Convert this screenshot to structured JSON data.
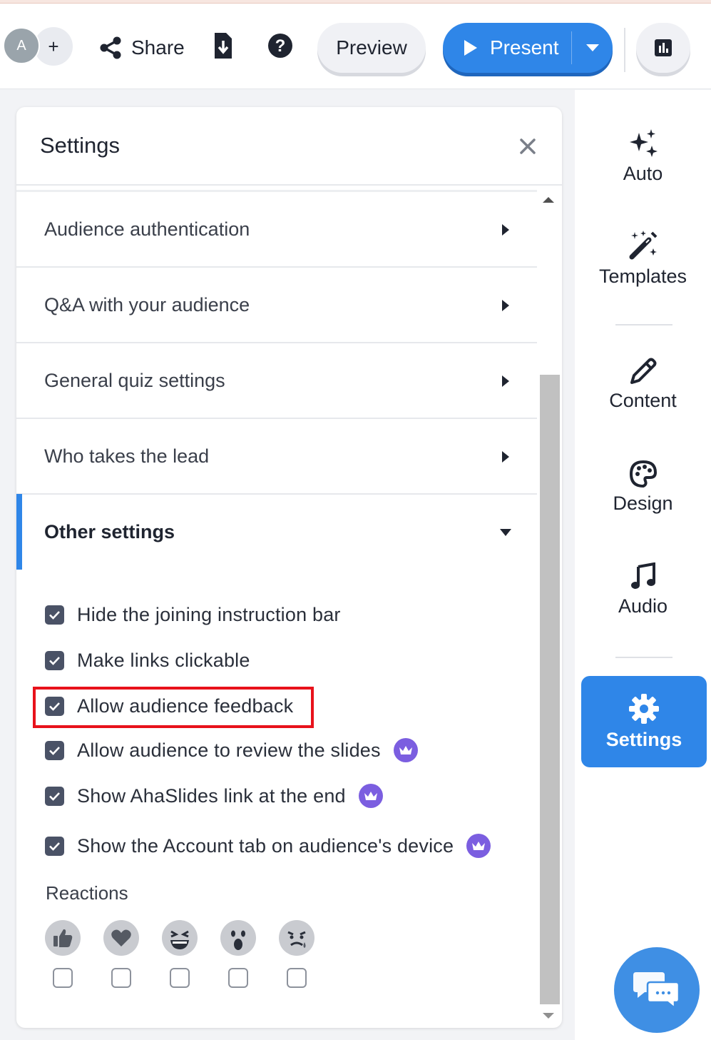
{
  "topbar": {
    "avatar_initial": "A",
    "add_label": "+",
    "share_label": "Share",
    "preview_label": "Preview",
    "present_label": "Present"
  },
  "settings": {
    "title": "Settings",
    "sections": [
      {
        "label": "Audience authentication"
      },
      {
        "label": "Q&A with your audience"
      },
      {
        "label": "General quiz settings"
      },
      {
        "label": "Who takes the lead"
      },
      {
        "label": "Other settings"
      }
    ],
    "options": [
      {
        "label": "Hide the joining instruction bar",
        "checked": true,
        "premium": false
      },
      {
        "label": "Make links clickable",
        "checked": true,
        "premium": false
      },
      {
        "label": "Allow audience feedback",
        "checked": true,
        "premium": false
      },
      {
        "label": "Allow audience to review the slides",
        "checked": true,
        "premium": true
      },
      {
        "label": "Show AhaSlides link at the end",
        "checked": true,
        "premium": true
      },
      {
        "label": "Show the Account tab on audience's device",
        "checked": true,
        "premium": true
      }
    ],
    "reactions_title": "Reactions",
    "reactions": [
      {
        "icon": "thumbs-up-icon",
        "checked": false
      },
      {
        "icon": "heart-icon",
        "checked": false
      },
      {
        "icon": "laughing-face-icon",
        "checked": false
      },
      {
        "icon": "surprised-face-icon",
        "checked": false
      },
      {
        "icon": "sad-face-icon",
        "checked": false
      }
    ]
  },
  "sidebar": {
    "items": [
      {
        "label": "Auto"
      },
      {
        "label": "Templates"
      },
      {
        "label": "Content"
      },
      {
        "label": "Design"
      },
      {
        "label": "Audio"
      },
      {
        "label": "Settings"
      }
    ]
  },
  "colors": {
    "accent": "#2f86e8",
    "highlight": "#e8121b",
    "premium": "#7b5ee0"
  }
}
